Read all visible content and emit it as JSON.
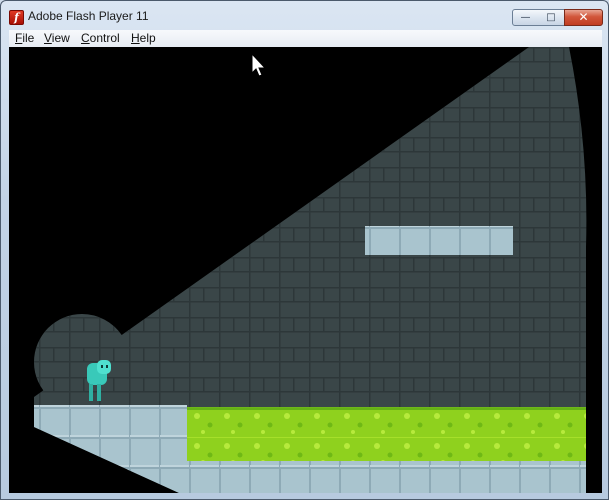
{
  "window": {
    "title": "Adobe Flash Player 11",
    "app_icon_glyph": "f",
    "controls": {
      "minimize": "—",
      "maximize": "□",
      "close": "✕"
    }
  },
  "menu": [
    {
      "label": "File",
      "mnemonic": "F"
    },
    {
      "label": "View",
      "mnemonic": "V"
    },
    {
      "label": "Control",
      "mnemonic": "C"
    },
    {
      "label": "Help",
      "mnemonic": "H"
    }
  ],
  "game": {
    "colors": {
      "background": "#000000",
      "wall_tile": "#3a4648",
      "wall_grid": "#2d3739",
      "light_tile": "#a9c4ce",
      "light_grid": "#8eaab6",
      "acid": "#8fd11e",
      "acid_dark": "#4a9b0f",
      "player": "#39c9b9"
    }
  },
  "cursor": "arrow-cursor"
}
